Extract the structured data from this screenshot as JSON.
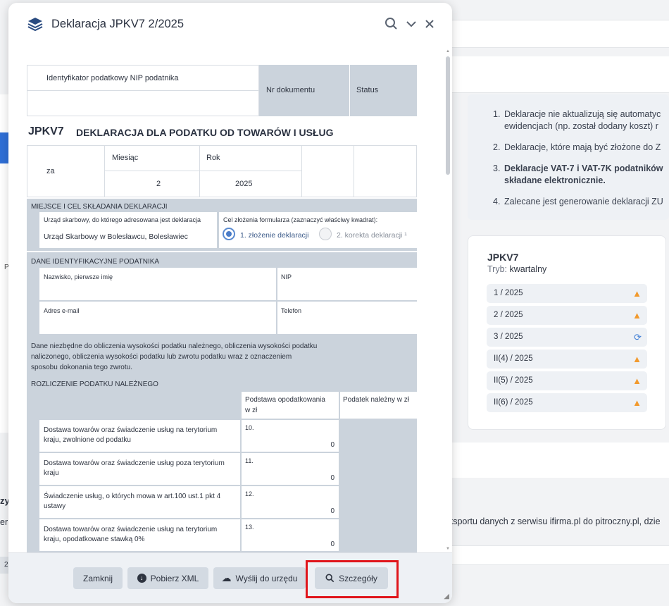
{
  "modal": {
    "title": "Deklaracja JPKV7 2/2025",
    "icons": [
      "layers-logo-icon",
      "search-icon",
      "chevron-down-icon",
      "close-icon"
    ]
  },
  "doc": {
    "nip_label": "Identyfikator podatkowy NIP podatnika",
    "doc_nr_label": "Nr dokumentu",
    "status_label": "Status",
    "code": "JPKV7",
    "heading": "DEKLARACJA DLA PODATKU OD TOWARÓW I USŁUG",
    "za_label": "za",
    "month_label": "Miesiąc",
    "year_label": "Rok",
    "month_value": "2",
    "year_value": "2025",
    "section_place": "MIEJSCE I CEL SKŁADANIA DEKLARACJI",
    "office_label": "Urząd skarbowy, do którego adresowana jest deklaracja",
    "office_value": "Urząd Skarbowy w Bolesławcu, Bolesławiec",
    "purpose_label": "Cel złożenia formularza (zaznaczyć właściwy kwadrat):",
    "purpose_opt1": "1. złożenie deklaracji",
    "purpose_opt2": "2. korekta deklaracji ¹",
    "section_ident": "DANE IDENTYFIKACYJNE PODATNIKA",
    "name_label": "Nazwisko, pierwsze imię",
    "nip_short": "NIP",
    "email_label": "Adres e-mail",
    "phone_label": "Telefon",
    "desc_line1": "Dane niezbędne do obliczenia wysokości podatku należnego, obliczenia wysokości podatku",
    "desc_line2": "naliczonego, obliczenia wysokości podatku lub zwrotu podatku wraz z oznaczeniem",
    "desc_line3": "sposobu dokonania tego zwrotu.",
    "section_calc": "ROZLICZENIE PODATKU NALEŻNEGO",
    "col_base_1": "Podstawa opodatkowania",
    "col_base_2": "w zł",
    "col_tax": "Podatek należny w zł",
    "rows": [
      {
        "l1": "Dostawa towarów oraz świadczenie usług na terytorium",
        "l2": "kraju, zwolnione od podatku",
        "nr": "10.",
        "val": "0"
      },
      {
        "l1": "Dostawa towarów oraz świadczenie usług poza terytorium",
        "l2": "kraju",
        "nr": "11.",
        "val": "0"
      },
      {
        "l1": "Świadczenie usług, o których mowa w art.100 ust.1 pkt 4",
        "l2": "ustawy",
        "nr": "12.",
        "val": "0"
      },
      {
        "l1": "Dostawa towarów oraz świadczenie usług na terytorium",
        "l2": "kraju, opodatkowane stawką 0%",
        "nr": "13.",
        "val": "0"
      }
    ]
  },
  "footer": {
    "close": "Zamknij",
    "download_xml": "Pobierz XML",
    "send": "Wyślij do urzędu",
    "details": "Szczegóły"
  },
  "background": {
    "notes": [
      "Deklaracje nie aktualizują się automatyc",
      "ewidencjach (np. został dodany koszt) r",
      "Deklaracje, które mają być złożone do Z",
      "Deklaracje VAT-7 i VAT-7K podatników",
      "składane elektronicznie.",
      "Zalecane jest generowanie deklaracji ZU"
    ],
    "note_nums": [
      "1.",
      "2.",
      "3.",
      "4."
    ],
    "card_title": "JPKV7",
    "mode_label": "Tryb:",
    "mode_value": "kwartalny",
    "periods": [
      {
        "label": "1 / 2025",
        "icon": "warning-icon"
      },
      {
        "label": "2 / 2025",
        "icon": "warning-icon"
      },
      {
        "label": "3 / 2025",
        "icon": "sync-icon"
      },
      {
        "label": "II(4) / 2025",
        "icon": "warning-icon"
      },
      {
        "label": "II(5) / 2025",
        "icon": "warning-icon"
      },
      {
        "label": "II(6) / 2025",
        "icon": "warning-icon"
      }
    ],
    "export_text": "eksportu danych z serwisu ifirma.pl do pitroczny.pl, dzie",
    "left_bold": "zy",
    "left_text": "er",
    "left_p": "P",
    "left_num": "2"
  },
  "colors": {
    "accent": "#2f6fd6",
    "warning": "#f29a2e",
    "highlight": "#e0151b",
    "header_grey": "#cbd3dc"
  }
}
